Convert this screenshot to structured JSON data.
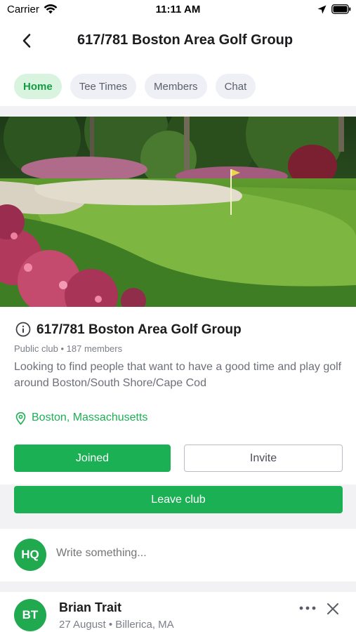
{
  "status_bar": {
    "carrier": "Carrier",
    "time": "11:11 AM",
    "icons": [
      "wifi-icon",
      "location-arrow-icon",
      "battery-icon"
    ]
  },
  "nav": {
    "back_icon": "chevron-left-icon",
    "title": "617/781 Boston Area Golf Group"
  },
  "tabs": [
    {
      "label": "Home",
      "active": true
    },
    {
      "label": "Tee Times",
      "active": false
    },
    {
      "label": "Members",
      "active": false
    },
    {
      "label": "Chat",
      "active": false
    }
  ],
  "club": {
    "info_icon": "info-circle-icon",
    "name": "617/781 Boston Area Golf Group",
    "meta": "Public club • 187 members",
    "description": "Looking to find people that want to have a good time and play golf around Boston/South Shore/Cape Cod",
    "location_icon": "map-pin-icon",
    "location": "Boston, Massachusetts"
  },
  "actions": {
    "joined_label": "Joined",
    "invite_label": "Invite",
    "leave_label": "Leave club"
  },
  "composer": {
    "avatar_initials": "HQ",
    "placeholder": "Write something..."
  },
  "post": {
    "avatar_initials": "BT",
    "author": "Brian Trait",
    "meta": "27 August • Billerica, MA",
    "more_icon": "more-horizontal-icon",
    "close_icon": "close-icon"
  },
  "colors": {
    "accent_green": "#1bb054",
    "active_tab_bg": "#d8f4df",
    "tab_bg": "#eef0f6",
    "avatar_green": "#20a94f"
  }
}
